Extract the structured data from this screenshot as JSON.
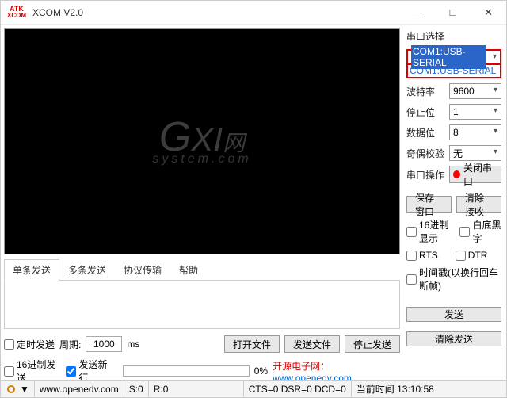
{
  "title": "XCOM V2.0",
  "win_controls": {
    "min": "—",
    "max": "□",
    "close": "✕"
  },
  "watermark": {
    "line1a": "G",
    "line1b": "XI",
    "net": "网",
    "line2": "system.com"
  },
  "tabs": [
    "单条发送",
    "多条发送",
    "协议传输",
    "帮助"
  ],
  "port": {
    "group_label": "串口选择",
    "selected": "COM1:USB-SERIAL",
    "option": "COM1:USB-SERIAL"
  },
  "fields": {
    "baud": {
      "label": "波特率",
      "value": "9600"
    },
    "stop": {
      "label": "停止位",
      "value": "1"
    },
    "data": {
      "label": "数据位",
      "value": "8"
    },
    "parity": {
      "label": "奇偶校验",
      "value": "无"
    },
    "op": {
      "label": "串口操作",
      "btn": "关闭串口"
    }
  },
  "buttons": {
    "save_window": "保存窗口",
    "clear_recv": "清除接收",
    "send": "发送",
    "clear_send": "清除发送",
    "open_file": "打开文件",
    "send_file": "发送文件",
    "stop_send": "停止发送"
  },
  "checks": {
    "hex_disp": "16进制显示",
    "white_black": "白底黑字",
    "rts": "RTS",
    "dtr": "DTR",
    "timestamp": "时间戳(以换行回车断帧)",
    "timed_send": "定时发送",
    "hex_send": "16进制发送",
    "send_newline": "发送新行"
  },
  "lower": {
    "period_label": "周期:",
    "period_value": "1000",
    "period_unit": "ms",
    "progress_pct": "0%",
    "link_text": "开源电子网：",
    "link_url": "www.openedv.com"
  },
  "status": {
    "drop": "▼",
    "site": "www.openedv.com",
    "s": "S:0",
    "r": "R:0",
    "cts": "CTS=0 DSR=0 DCD=0",
    "time_label": "当前时间 13:10:58"
  }
}
